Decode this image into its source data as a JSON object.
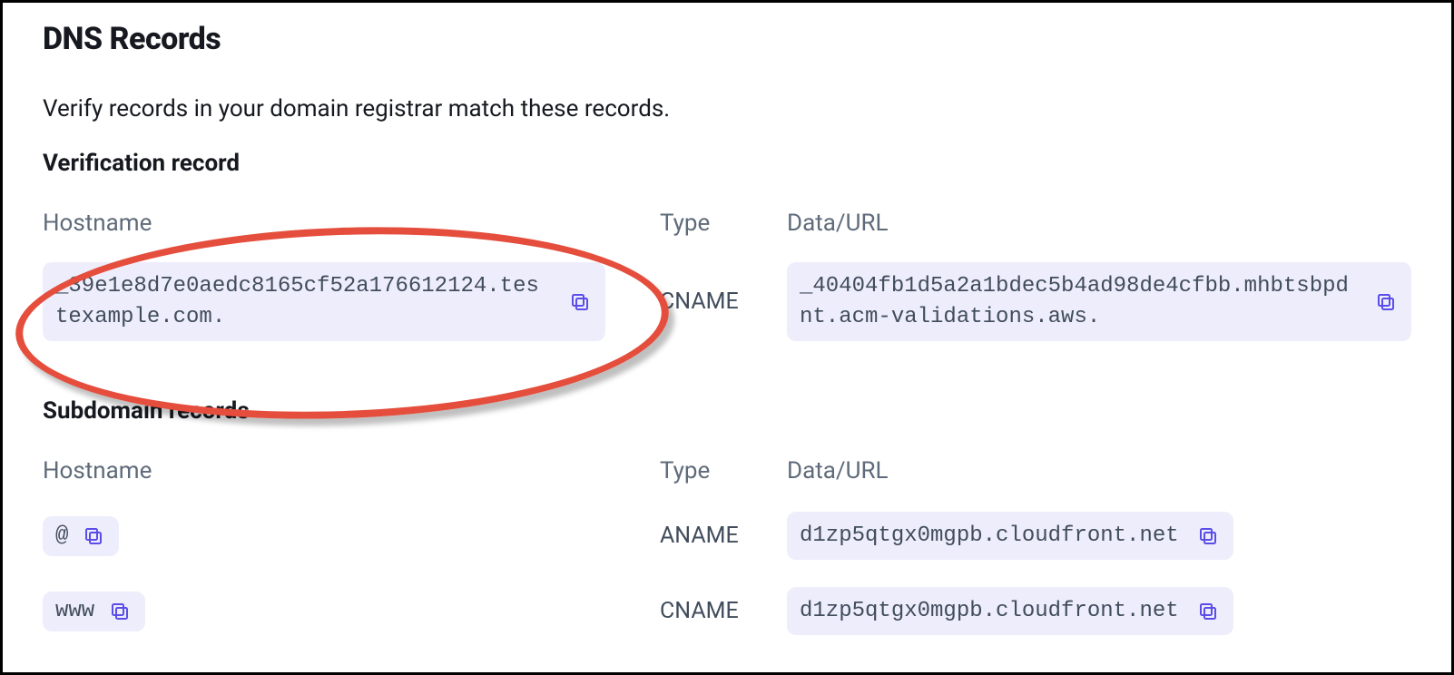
{
  "page": {
    "title": "DNS Records",
    "description": "Verify records in your domain registrar match these records."
  },
  "verification": {
    "heading": "Verification record",
    "columns": {
      "hostname": "Hostname",
      "type": "Type",
      "data": "Data/URL"
    },
    "record": {
      "hostname": "_39e1e8d7e0aedc8165cf52a176612124.testexample.com.",
      "type": "CNAME",
      "data": "_40404fb1d5a2a1bdec5b4ad98de4cfbb.mhbtsbpdnt.acm-validations.aws."
    }
  },
  "subdomain": {
    "heading": "Subdomain records",
    "columns": {
      "hostname": "Hostname",
      "type": "Type",
      "data": "Data/URL"
    },
    "records": [
      {
        "hostname": "@",
        "type": "ANAME",
        "data": "d1zp5qtgx0mgpb.cloudfront.net"
      },
      {
        "hostname": "www",
        "type": "CNAME",
        "data": "d1zp5qtgx0mgpb.cloudfront.net"
      }
    ]
  }
}
